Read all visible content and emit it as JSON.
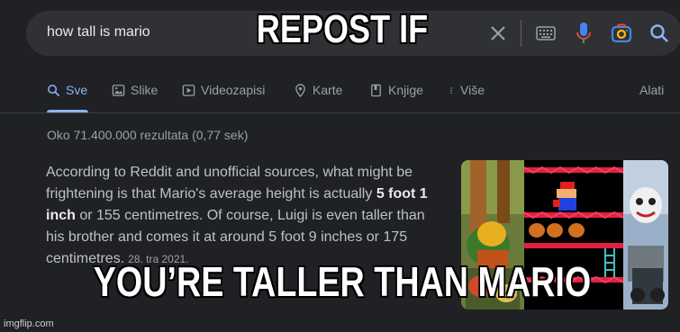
{
  "search": {
    "query": "how tall is mario"
  },
  "tabs": [
    {
      "label": "Sve",
      "icon": "search-icon",
      "active": true
    },
    {
      "label": "Slike",
      "icon": "image-icon"
    },
    {
      "label": "Videozapisi",
      "icon": "video-icon"
    },
    {
      "label": "Karte",
      "icon": "map-pin-icon"
    },
    {
      "label": "Knjige",
      "icon": "book-icon"
    },
    {
      "label": "Više",
      "icon": "more-icon"
    }
  ],
  "tools_label": "Alati",
  "result_stats": "Oko 71.400.000 rezultata (0,77 sek)",
  "snippet": {
    "part1": "According to Reddit and unofficial sources, what might be frightening is that Mario's average height is actually ",
    "bold1": "5 foot 1 inch",
    "part2": " or 155 centimetres. Of course, Luigi is even taller than his brother and comes it at around 5 foot 9 inches or 175 centimetres.",
    "date": "28. tra 2021."
  },
  "meme": {
    "top": "REPOST IF",
    "bottom": "YOU’RE TALLER THAN MARIO"
  },
  "watermark": "imgflip.com",
  "colors": {
    "background": "#202124",
    "accent": "#8ab4f8",
    "searchbar": "#303134"
  }
}
